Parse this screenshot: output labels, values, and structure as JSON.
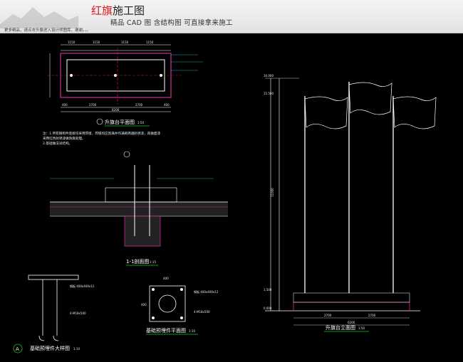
{
  "banner": {
    "brand_red": "红旗",
    "brand_rest": "施工图",
    "subtitle": "精品 CAD 图    含结构图  可直接拿来施工",
    "note": "更多精品，请点击头像进入设计师图库，谢谢。。。"
  },
  "drawing": {
    "plan_title": "升旗台平面图",
    "plan_scale": "1:50",
    "section_title": "1-1剖面图",
    "section_scale": "1:15",
    "detail_title": "基础预埋件大样图",
    "detail_scale": "1:10",
    "detail_marker": "A",
    "embed_title": "基础预埋件平面图",
    "embed_scale": "1:10",
    "elevation_title": "升旗台立面图",
    "elevation_scale": "1:50",
    "notes_line1": "注：1.所有钢构件连接均采用焊接，焊缝均应饱满并作满刷两遍防锈漆，再做面漆",
    "notes_line2": "    采用红色防锈漆做防腐处理。",
    "notes_line3": "   2.基础做法详结构。",
    "plan_dims_top": [
      "1150",
      "1150",
      "1150",
      "1150"
    ],
    "plan_dims_bottom": [
      "400",
      "2700",
      "2700",
      "400"
    ],
    "plan_total": "6200",
    "elev_heights": [
      "16.000",
      "15.500",
      "11000",
      "1.500",
      "0.000"
    ],
    "elev_dims_bottom": [
      "2700",
      "2700"
    ],
    "elev_total": "6200",
    "embed_dims": [
      "400",
      "400"
    ],
    "detail_labels": [
      "钢板 400x400x12",
      "4-M18x500",
      "钢板 400x400x12",
      "4-M18x500"
    ]
  },
  "colors": {
    "line": "#ffffff",
    "magenta": "#cc2f9c",
    "green": "#22c322",
    "cyan": "#2ad4dc",
    "red": "#e02525",
    "yellow": "#e2d12a"
  }
}
